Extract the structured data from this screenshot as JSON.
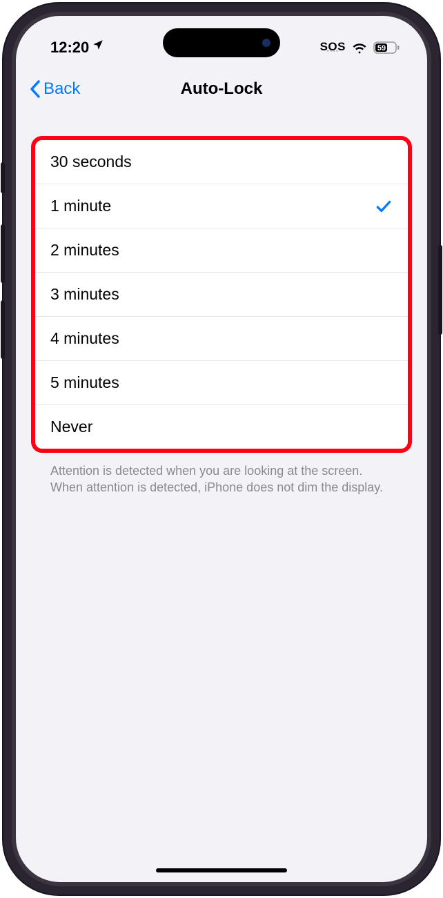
{
  "status": {
    "time": "12:20",
    "sos": "SOS",
    "battery": "59"
  },
  "nav": {
    "back_label": "Back",
    "title": "Auto-Lock"
  },
  "options": [
    {
      "label": "30 seconds",
      "selected": false
    },
    {
      "label": "1 minute",
      "selected": true
    },
    {
      "label": "2 minutes",
      "selected": false
    },
    {
      "label": "3 minutes",
      "selected": false
    },
    {
      "label": "4 minutes",
      "selected": false
    },
    {
      "label": "5 minutes",
      "selected": false
    },
    {
      "label": "Never",
      "selected": false
    }
  ],
  "footer": "Attention is detected when you are looking at the screen. When attention is detected, iPhone does not dim the display."
}
